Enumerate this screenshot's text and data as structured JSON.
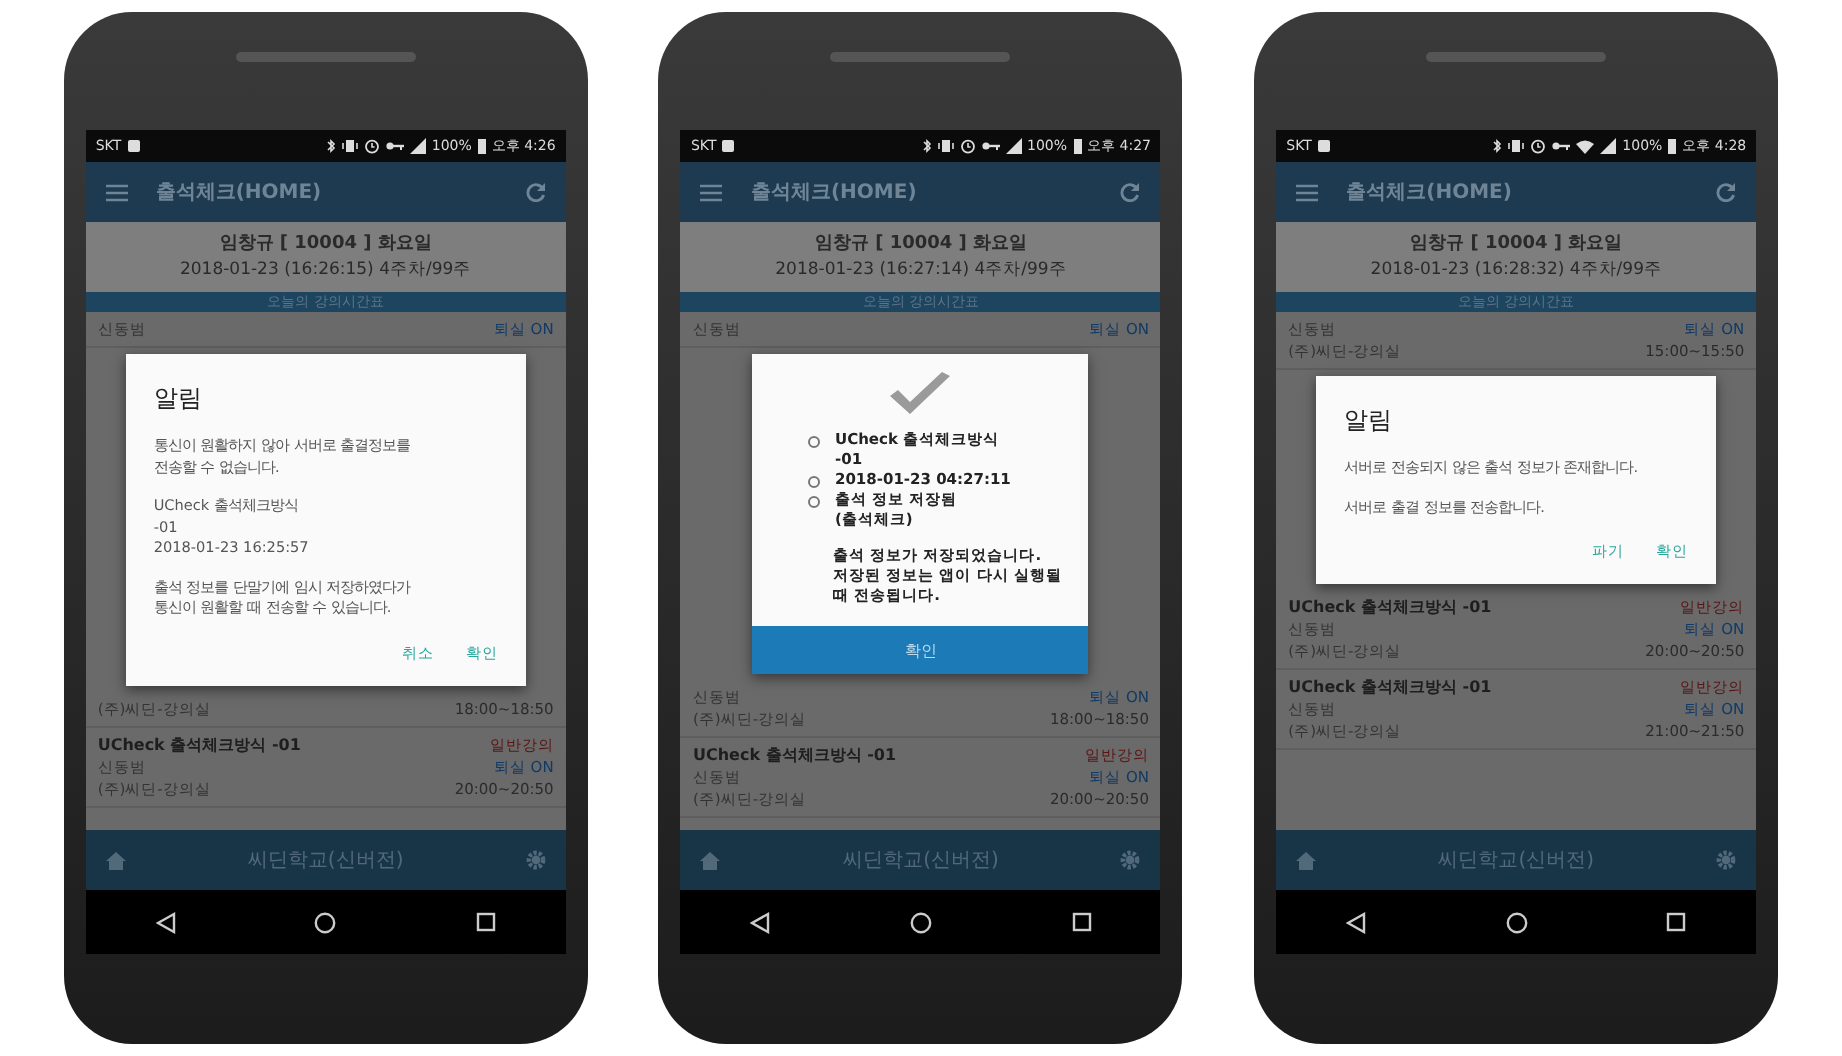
{
  "phones": [
    {
      "status_bar": {
        "carrier": "SKT",
        "battery": "100%",
        "time": "오후 4:26",
        "wifi": false
      },
      "app_bar": {
        "title": "출석체크(HOME)"
      },
      "header": {
        "name": "임창규 [ 10004 ] 화요일",
        "date": "2018-01-23 (16:26:15) 4주차/99주"
      },
      "section_label": "오늘의 강의시간표",
      "rows_above": [
        {
          "person": "신동범",
          "status": "퇴실 ON"
        }
      ],
      "dialog": {
        "kind": "alert",
        "title": "알림",
        "paragraphs": [
          "통신이 원활하지 않아 서버로 출결정보를\n전송할 수 없습니다.",
          "UCheck 출석체크방식\n-01\n2018-01-23 16:25:57",
          "출석 정보를 단말기에 임시 저장하였다가\n통신이 원활할 때 전송할 수 있습니다."
        ],
        "buttons": [
          "취소",
          "확인"
        ]
      },
      "rows_below": [
        {
          "place": "(주)씨딘-강의실",
          "time": "18:00~18:50"
        },
        {
          "title": "UCheck 출석체크방식 -01",
          "category": "일반강의",
          "person": "신동범",
          "status": "퇴실 ON",
          "place": "(주)씨딘-강의실",
          "time": "20:00~20:50"
        }
      ],
      "bottom_bar": {
        "title": "씨딘학교(신버전)"
      }
    },
    {
      "status_bar": {
        "carrier": "SKT",
        "battery": "100%",
        "time": "오후 4:27",
        "wifi": false
      },
      "app_bar": {
        "title": "출석체크(HOME)"
      },
      "header": {
        "name": "임창규 [ 10004 ] 화요일",
        "date": "2018-01-23 (16:27:14) 4주차/99주"
      },
      "section_label": "오늘의 강의시간표",
      "rows_above": [
        {
          "person": "신동범",
          "status": "퇴실 ON"
        }
      ],
      "dialog": {
        "kind": "success",
        "items": [
          "UCheck 출석체크방식\n-01",
          "2018-01-23 04:27:11",
          "출석 정보 저장됨\n(출석체크)"
        ],
        "message": "출석 정보가 저장되었습니다.\n저장된 정보는 앱이 다시 실행될\n때 전송됩니다.",
        "button": "확인"
      },
      "rows_below": [
        {
          "person": "신동범",
          "status": "퇴실 ON",
          "place": "(주)씨딘-강의실",
          "time": "18:00~18:50"
        },
        {
          "title": "UCheck 출석체크방식 -01",
          "category": "일반강의",
          "person": "신동범",
          "status": "퇴실 ON",
          "place": "(주)씨딘-강의실",
          "time": "20:00~20:50"
        }
      ],
      "bottom_bar": {
        "title": "씨딘학교(신버전)"
      }
    },
    {
      "status_bar": {
        "carrier": "SKT",
        "battery": "100%",
        "time": "오후 4:28",
        "wifi": true
      },
      "app_bar": {
        "title": "출석체크(HOME)"
      },
      "header": {
        "name": "임창규 [ 10004 ] 화요일",
        "date": "2018-01-23 (16:28:32) 4주차/99주"
      },
      "section_label": "오늘의 강의시간표",
      "rows_above": [
        {
          "person": "신동범",
          "status": "퇴실 ON",
          "place": "(주)씨딘-강의실",
          "time": "15:00~15:50"
        }
      ],
      "dialog": {
        "kind": "alert",
        "title": "알림",
        "paragraphs": [
          "서버로 전송되지 않은 출석 정보가 존재합니다.",
          "서버로 출결 정보를 전송합니다."
        ],
        "buttons": [
          "파기",
          "확인"
        ]
      },
      "rows_below": [
        {
          "title": "UCheck 출석체크방식 -01",
          "category": "일반강의",
          "person": "신동범",
          "status": "퇴실 ON",
          "place": "(주)씨딘-강의실",
          "time": "20:00~20:50"
        },
        {
          "title": "UCheck 출석체크방식 -01",
          "category": "일반강의",
          "person": "신동범",
          "status": "퇴실 ON",
          "place": "(주)씨딘-강의실",
          "time": "21:00~21:50"
        }
      ],
      "bottom_bar": {
        "title": "씨딘학교(신버전)"
      }
    }
  ]
}
